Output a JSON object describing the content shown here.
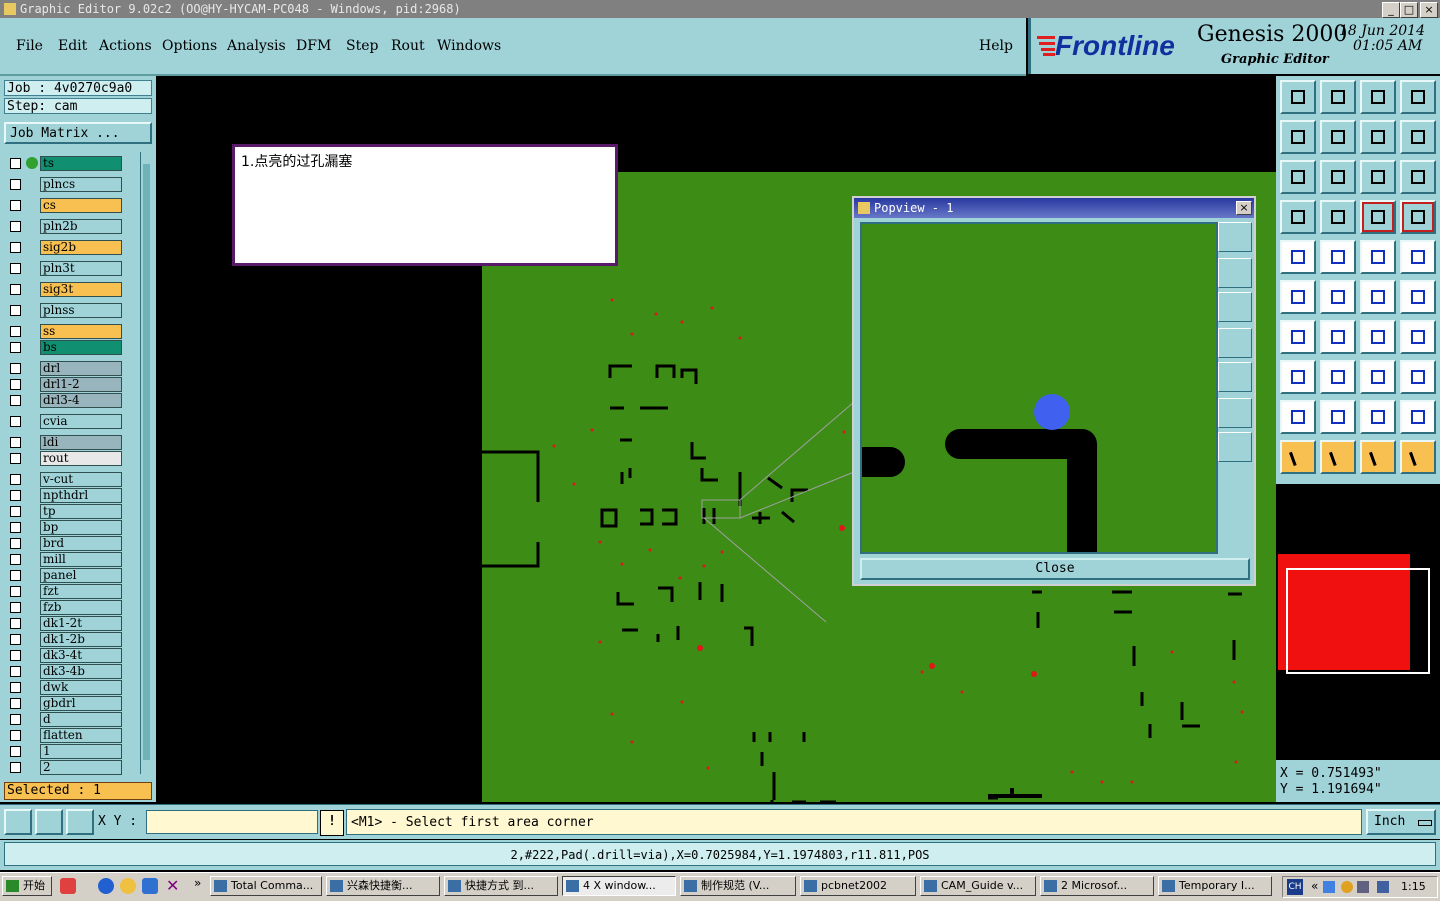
{
  "window": {
    "title": "Graphic Editor 9.02c2 (OO@HY-HYCAM-PC048 - Windows, pid:2968)",
    "min": "_",
    "max": "□",
    "close": "×"
  },
  "menu": [
    "File",
    "Edit",
    "Actions",
    "Options",
    "Analysis",
    "DFM",
    "Step",
    "Rout",
    "Windows"
  ],
  "help": "Help",
  "brand": {
    "logo": "Frontline",
    "product": "Genesis 2000",
    "subtitle": "Graphic Editor",
    "date": "18 Jun 2014",
    "time": "01:05 AM"
  },
  "job": {
    "job": "Job : 4v0270c9a0",
    "step": "Step: cam",
    "matrix_button": "Job Matrix ..."
  },
  "layers": [
    {
      "name": "ts",
      "color": "green"
    },
    {
      "name": "plncs",
      "color": "teal"
    },
    {
      "name": "cs",
      "color": "orange"
    },
    {
      "name": "pln2b",
      "color": "teal"
    },
    {
      "name": "sig2b",
      "color": "orange"
    },
    {
      "name": "pln3t",
      "color": "teal"
    },
    {
      "name": "sig3t",
      "color": "orange"
    },
    {
      "name": "plnss",
      "color": "teal"
    },
    {
      "name": "ss",
      "color": "orange"
    },
    {
      "name": "bs",
      "color": "green"
    },
    {
      "name": "drl",
      "color": "gray"
    },
    {
      "name": "drl1-2",
      "color": "gray"
    },
    {
      "name": "drl3-4",
      "color": "gray"
    },
    {
      "name": "cvia",
      "color": "teal"
    },
    {
      "name": "ldi",
      "color": "gray"
    },
    {
      "name": "rout",
      "color": "white"
    },
    {
      "name": "v-cut",
      "color": "teal"
    },
    {
      "name": "npthdrl",
      "color": "teal"
    },
    {
      "name": "tp",
      "color": "teal"
    },
    {
      "name": "bp",
      "color": "teal"
    },
    {
      "name": "brd",
      "color": "teal"
    },
    {
      "name": "mill",
      "color": "teal"
    },
    {
      "name": "panel",
      "color": "teal"
    },
    {
      "name": "fzt",
      "color": "teal"
    },
    {
      "name": "fzb",
      "color": "teal"
    },
    {
      "name": "dk1-2t",
      "color": "teal"
    },
    {
      "name": "dk1-2b",
      "color": "teal"
    },
    {
      "name": "dk3-4t",
      "color": "teal"
    },
    {
      "name": "dk3-4b",
      "color": "teal"
    },
    {
      "name": "dwk",
      "color": "teal"
    },
    {
      "name": "gbdrl",
      "color": "teal"
    },
    {
      "name": "d",
      "color": "teal"
    },
    {
      "name": "flatten",
      "color": "teal"
    },
    {
      "name": "1",
      "color": "teal"
    },
    {
      "name": "2",
      "color": "teal"
    }
  ],
  "selected": "Selected : 1",
  "note": "1.点亮的过孔漏塞",
  "popview": {
    "title": "Popview - 1",
    "close": "Close"
  },
  "coords": {
    "x": "X = 0.751493\"",
    "y": "Y = 1.191694\""
  },
  "cmd": {
    "xy_label": "X Y :",
    "xy_value": "",
    "prompt": "<M1> - Select first area corner",
    "units": "Inch"
  },
  "status": "2,#222,Pad(.drill=via),X=0.7025984,Y=1.1974803,r11.811,POS",
  "taskbar": {
    "start": "开始",
    "tasks": [
      "Total Comma...",
      "兴森快捷衡...",
      "快捷方式 到...",
      "4 X window...",
      "制作规范 (V...",
      "pcbnet2002",
      "CAM_Guide v...",
      "2 Microsof...",
      "Temporary I..."
    ],
    "lang": "CH",
    "clock": "1:15"
  }
}
